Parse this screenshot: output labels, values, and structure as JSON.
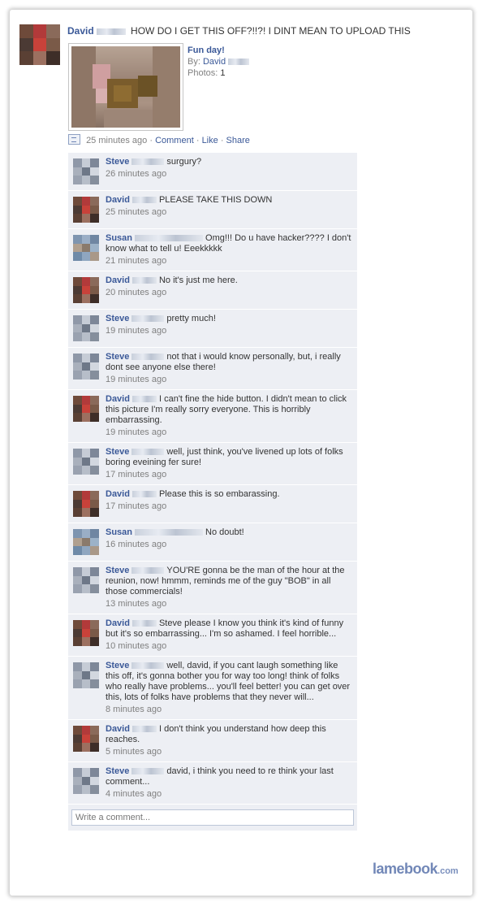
{
  "post": {
    "author": "David",
    "status": "HOW DO I GET THIS OFF?!!?! I DINT MEAN TO UPLOAD THIS",
    "album": {
      "title": "Fun day!",
      "by_label": "By:",
      "by_name": "David",
      "photos_label": "Photos:",
      "photos_count": "1"
    },
    "actions": {
      "time": "25 minutes ago",
      "sep": "·",
      "comment": "Comment",
      "like": "Like",
      "share": "Share"
    }
  },
  "comments": [
    {
      "author": "Steve",
      "text": "surgury?",
      "time": "26 minutes ago",
      "avatar": "steve"
    },
    {
      "author": "David",
      "text": "PLEASE TAKE THIS DOWN",
      "time": "25 minutes ago",
      "avatar": "david"
    },
    {
      "author": "Susan",
      "text": "Omg!!! Do u have hacker???? I don't know what to tell u! Eeekkkkk",
      "time": "21 minutes ago",
      "avatar": "susan"
    },
    {
      "author": "David",
      "text": "No it's just me here.",
      "time": "20 minutes ago",
      "avatar": "david"
    },
    {
      "author": "Steve",
      "text": "pretty much!",
      "time": "19 minutes ago",
      "avatar": "steve"
    },
    {
      "author": "Steve",
      "text": "not that i would know personally, but, i really dont see anyone else there!",
      "time": "19 minutes ago",
      "avatar": "steve"
    },
    {
      "author": "David",
      "text": "I can't fine the hide button. I didn't mean to click this picture I'm really sorry everyone. This is horribly embarrassing.",
      "time": "19 minutes ago",
      "avatar": "david"
    },
    {
      "author": "Steve",
      "text": "well, just think, you've livened up lots of folks boring eveining fer sure!",
      "time": "17 minutes ago",
      "avatar": "steve"
    },
    {
      "author": "David",
      "text": "Please this is so embarassing.",
      "time": "17 minutes ago",
      "avatar": "david"
    },
    {
      "author": "Susan",
      "text": "No doubt!",
      "time": "16 minutes ago",
      "avatar": "susan"
    },
    {
      "author": "Steve",
      "text": "YOU'RE gonna be the man of the hour at the reunion, now! hmmm, reminds me of the guy \"BOB\" in all those commercials!",
      "time": "13 minutes ago",
      "avatar": "steve"
    },
    {
      "author": "David",
      "text": "Steve please I know you think it's kind of funny but it's so embarrassing... I'm so ashamed. I feel horrible...",
      "time": "10 minutes ago",
      "avatar": "david"
    },
    {
      "author": "Steve",
      "text": "well, david, if you cant laugh something like this off, it's gonna bother you for way too long! think of folks who really have problems... you'll feel better! you can get over this, lots of folks have problems that they never will...",
      "time": "8 minutes ago",
      "avatar": "steve"
    },
    {
      "author": "David",
      "text": "I don't think you understand how deep this reaches.",
      "time": "5 minutes ago",
      "avatar": "david"
    },
    {
      "author": "Steve",
      "text": "david, i think you need to re think your last comment...",
      "time": "4 minutes ago",
      "avatar": "steve"
    }
  ],
  "comment_box": {
    "placeholder": "Write a comment..."
  },
  "watermark": {
    "name": "lamebook",
    "tld": ".com"
  },
  "colors": {
    "link": "#3b5998",
    "comment_bg": "#edeff4",
    "muted": "#808080"
  }
}
